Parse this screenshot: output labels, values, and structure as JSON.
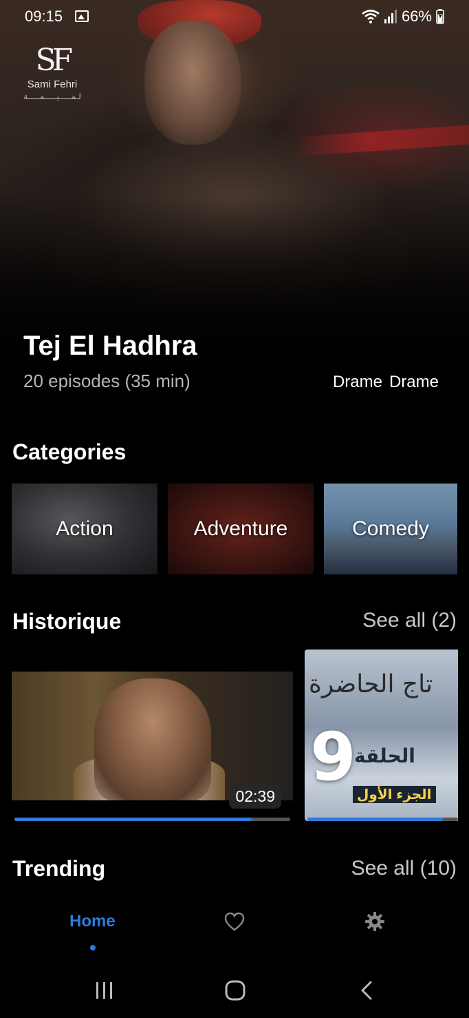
{
  "status_bar": {
    "time": "09:15",
    "battery": "66%",
    "icons": [
      "gallery-icon",
      "wifi-icon",
      "signal-icon",
      "battery-icon"
    ]
  },
  "logo": {
    "mark": "SF",
    "name": "Sami Fehri",
    "arabic": "لـمـــــيـــــمـــــة"
  },
  "hero": {
    "title": "Tej El Hadhra",
    "meta": "20 episodes (35 min)",
    "genres": [
      "Drame",
      "Drame"
    ]
  },
  "categories": {
    "title": "Categories",
    "items": [
      {
        "label": "Action"
      },
      {
        "label": "Adventure"
      },
      {
        "label": "Comedy"
      }
    ]
  },
  "historique": {
    "title": "Historique",
    "see_all": "See all (2)",
    "items": [
      {
        "duration": "02:39",
        "progress": 0.86
      },
      {
        "number": "9",
        "episode_word": "الحلقة",
        "part": "الجزء الأول",
        "show_title": "تاج الحاضرة",
        "progress": 0.9
      }
    ]
  },
  "trending": {
    "title": "Trending",
    "see_all": "See all (10)"
  },
  "bottom_nav": {
    "home": "Home",
    "icons": [
      "heart-icon",
      "gear-icon"
    ],
    "accent": "#2f7bdc"
  },
  "system_nav": {
    "icons": [
      "recents-icon",
      "home-icon",
      "back-icon"
    ]
  }
}
